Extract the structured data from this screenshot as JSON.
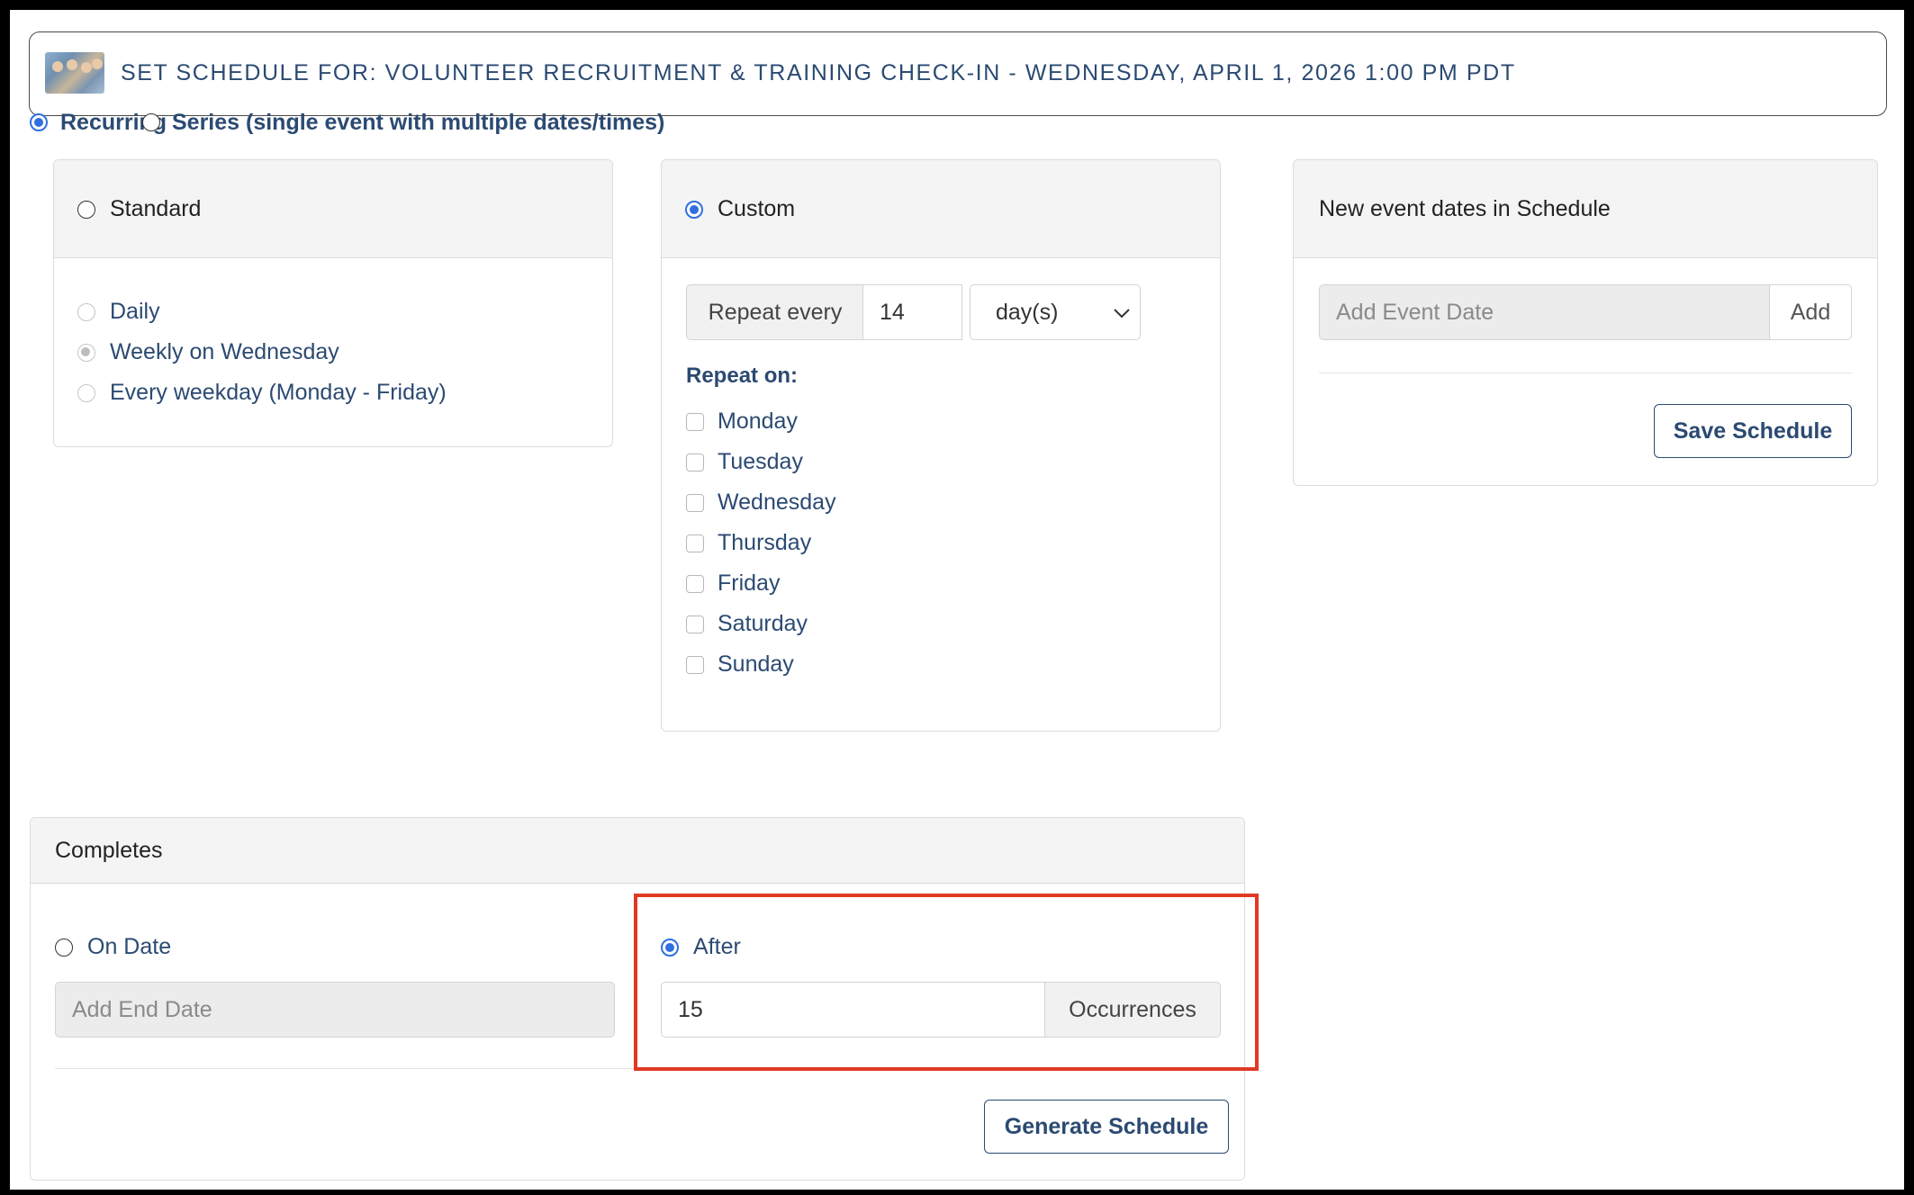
{
  "header": {
    "title": "SET SCHEDULE FOR: VOLUNTEER RECRUITMENT & TRAINING CHECK-IN - WEDNESDAY, APRIL 1, 2026 1:00 PM PDT"
  },
  "schedule_type": {
    "recurring_label": "Recurring",
    "series_label": "Series (single event with multiple dates/times)",
    "selected": "Recurring"
  },
  "standard": {
    "heading": "Standard",
    "options": [
      "Daily",
      "Weekly on Wednesday",
      "Every weekday (Monday - Friday)"
    ],
    "selected": "Weekly on Wednesday"
  },
  "custom": {
    "heading": "Custom",
    "repeat_every_label": "Repeat every",
    "repeat_every_value": "14",
    "unit_selected": "day(s)",
    "repeat_on_label": "Repeat on:",
    "days": [
      "Monday",
      "Tuesday",
      "Wednesday",
      "Thursday",
      "Friday",
      "Saturday",
      "Sunday"
    ]
  },
  "new_dates": {
    "heading": "New event dates in Schedule",
    "add_placeholder": "Add Event Date",
    "add_label": "Add",
    "save_label": "Save Schedule"
  },
  "completes": {
    "heading": "Completes",
    "on_date_label": "On Date",
    "end_date_placeholder": "Add End Date",
    "after_label": "After",
    "occurrences_value": "15",
    "occurrences_label": "Occurrences",
    "selected": "After",
    "generate_label": "Generate Schedule"
  },
  "colors": {
    "accent": "#2f6fe0",
    "text_blue": "#2b4a72",
    "highlight_red": "#e03a24"
  }
}
